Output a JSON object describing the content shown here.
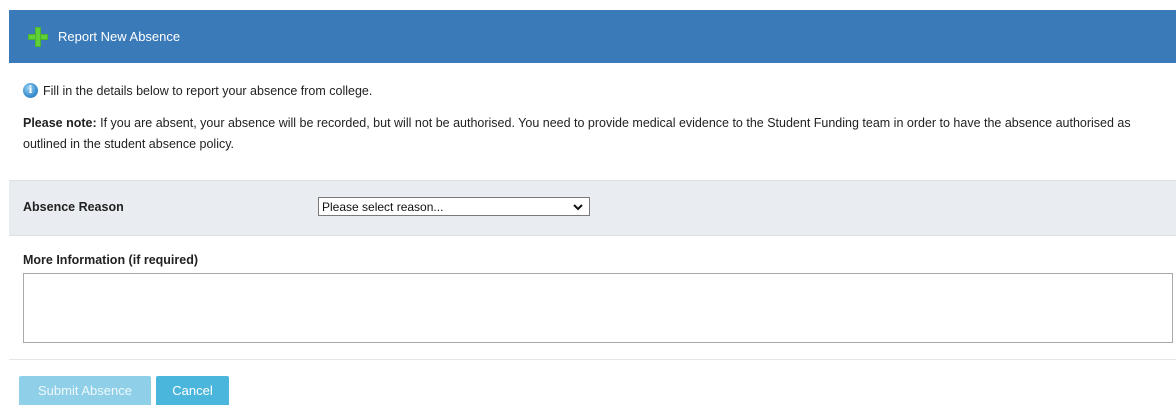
{
  "header": {
    "title": "Report New Absence",
    "icon": "plus-icon",
    "background": "#3a7ab8",
    "icon_color": "#5fcf3a"
  },
  "info": {
    "icon": "info-icon",
    "text": "Fill in the details below to report your absence from college."
  },
  "note": {
    "label": "Please note:",
    "text": " If you are absent, your absence will be recorded, but will not be authorised. You need to provide medical evidence to the Student Funding team in order to have the absence authorised as outlined in the student absence policy."
  },
  "form": {
    "absence_reason": {
      "label": "Absence Reason",
      "selected": "Please select reason..."
    },
    "more_information": {
      "label": "More Information (if required)",
      "value": ""
    }
  },
  "buttons": {
    "submit_label": "Submit Absence",
    "cancel_label": "Cancel",
    "submit_color": "#8fd0e8",
    "cancel_color": "#4bb6dc"
  }
}
